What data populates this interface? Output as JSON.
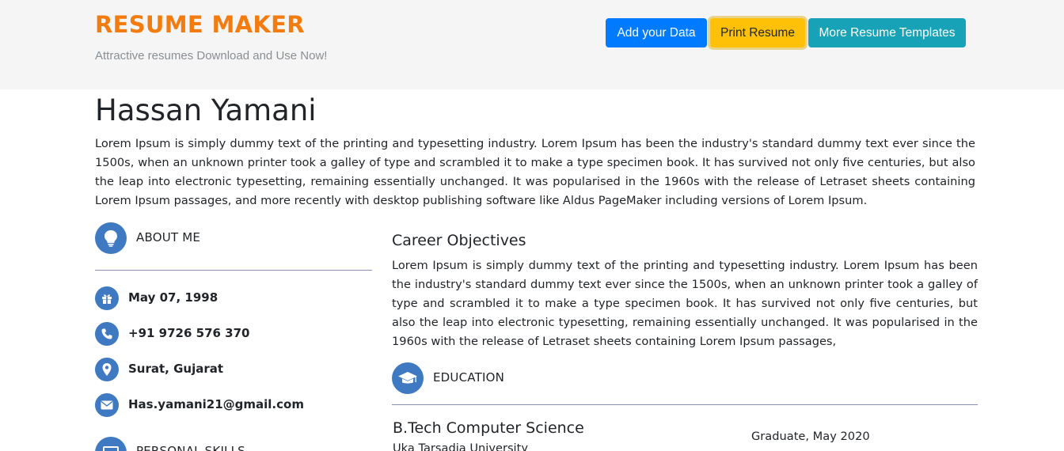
{
  "header": {
    "brand": "RESUME MAKER",
    "tagline": "Attractive resumes Download and Use Now!",
    "buttons": {
      "add_data": "Add your Data",
      "print": "Print Resume",
      "more_templates": "More Resume Templates"
    }
  },
  "resume": {
    "name": "Hassan Yamani",
    "intro": "Lorem Ipsum is simply dummy text of the printing and typesetting industry. Lorem Ipsum has been the industry's standard dummy text ever since the 1500s, when an unknown printer took a galley of type and scrambled it to make a type specimen book. It has survived not only five centuries, but also the leap into electronic typesetting, remaining essentially unchanged. It was popularised in the 1960s with the release of Letraset sheets containing Lorem Ipsum passages, and more recently with desktop publishing software like Aldus PageMaker including versions of Lorem Ipsum.",
    "about": {
      "heading": "ABOUT ME",
      "icon": "lightbulb-icon",
      "dob": "May 07, 1998",
      "phone": "+91 9726 576 370",
      "location": "Surat, Gujarat",
      "email": "Has.yamani21@gmail.com"
    },
    "skills": {
      "heading": "PERSONAL SKILLS",
      "icon": "monitor-icon"
    },
    "career": {
      "heading": "Career Objectives",
      "text": "Lorem Ipsum is simply dummy text of the printing and typesetting industry. Lorem Ipsum has been the industry's standard dummy text ever since the 1500s, when an unknown printer took a galley of type and scrambled it to make a type specimen book. It has survived not only five centuries, but also the leap into electronic typesetting, remaining essentially unchanged. It was popularised in the 1960s with the release of Letraset sheets containing Lorem Ipsum passages,"
    },
    "education": {
      "heading": "EDUCATION",
      "icon": "graduation-cap-icon",
      "degree": "B.Tech Computer Science",
      "date": "Graduate, May 2020",
      "university": "Uka Tarsadia University"
    }
  },
  "colors": {
    "brand": "#f47c0f",
    "icon_bg": "#3e79c1",
    "primary": "#007bff",
    "warning": "#ffc107",
    "info": "#17a2b8",
    "rule": "#8c8fb8"
  }
}
